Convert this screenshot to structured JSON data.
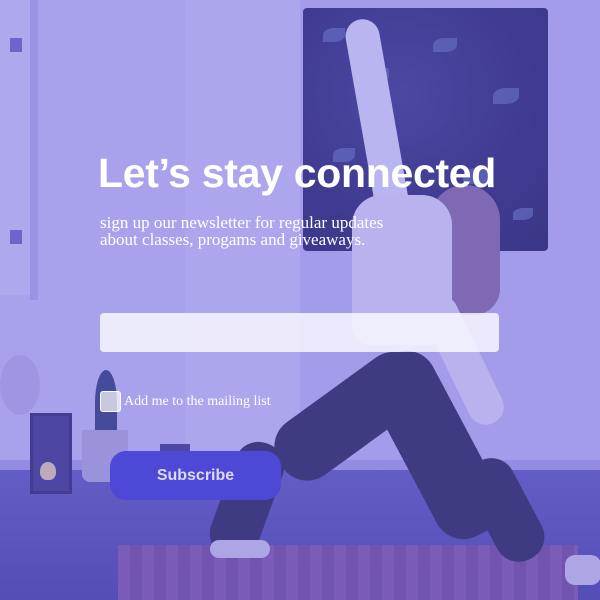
{
  "form": {
    "headline": "Let’s stay connected",
    "subtitle": "sign up our newsletter for regular updates about classes, progams and giveaways.",
    "email_value": "",
    "email_placeholder": "",
    "checkbox_label": "Add me to the mailing list",
    "checkbox_checked": false,
    "subscribe_label": "Subscribe"
  },
  "colors": {
    "overlay": "#6862dc",
    "button": "#4e48d6",
    "text": "#ffffff"
  }
}
